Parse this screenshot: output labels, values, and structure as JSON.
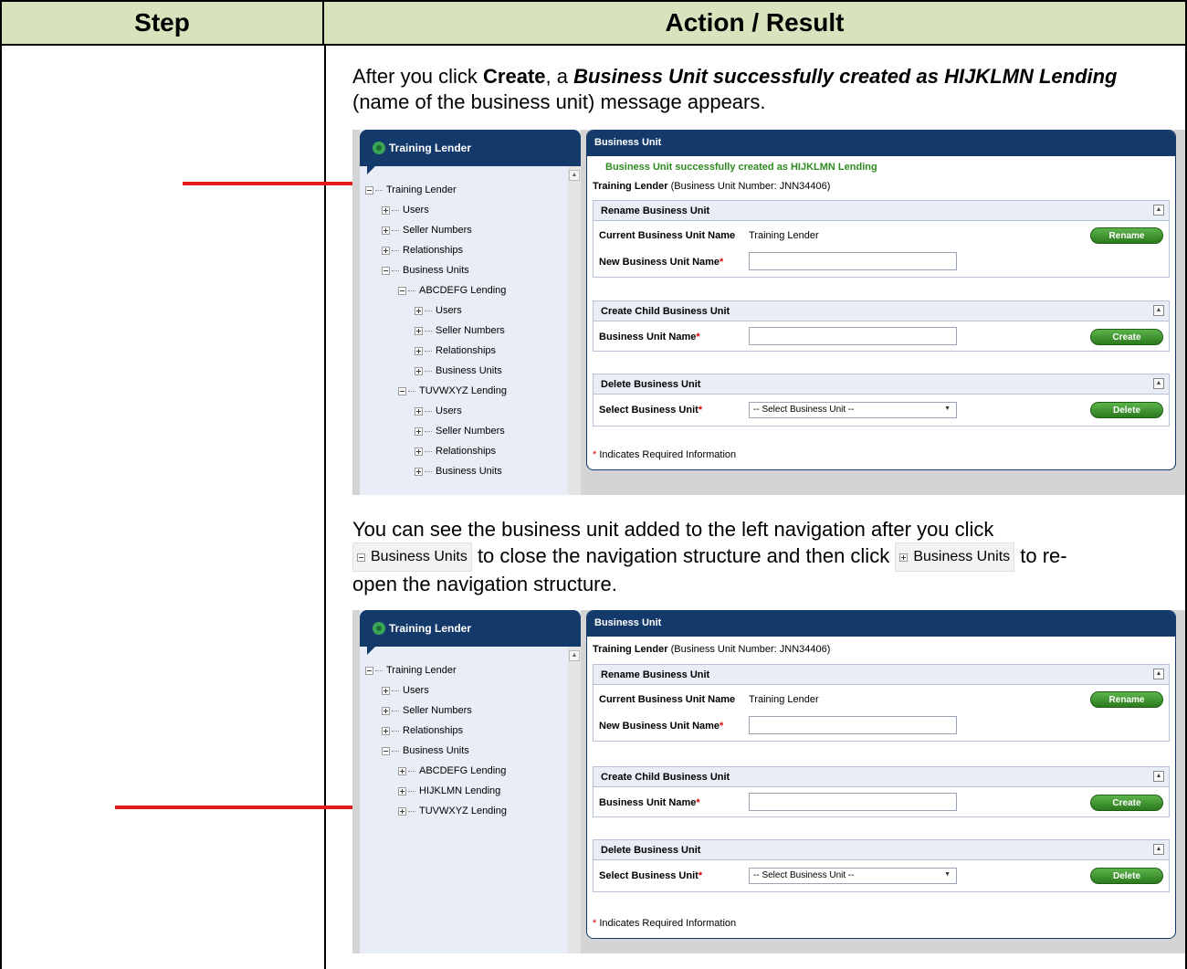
{
  "doc": {
    "header_step": "Step",
    "header_action": "Action / Result",
    "para1_pre": "After you click ",
    "para1_create": "Create",
    "para1_mid": ", a ",
    "para1_msg": "Business Unit successfully created as HIJKLMN Lending",
    "para1_post": " (name of the business unit) message appears.",
    "para2_a": "You can see the business unit added to the left navigation after you click",
    "para2_b": " to close the navigation structure and then click ",
    "para2_c": " to re-",
    "para2_d": "open the navigation structure.",
    "chip_label": "Business Units"
  },
  "shot1": {
    "nav_title": "Training Lender",
    "tree": [
      "Training Lender",
      "Users",
      "Seller Numbers",
      "Relationships",
      "Business Units",
      "ABCDEFG Lending",
      "Users",
      "Seller Numbers",
      "Relationships",
      "Business Units",
      "TUVWXYZ Lending",
      "Users",
      "Seller Numbers",
      "Relationships",
      "Business Units"
    ],
    "panel_title": "Business Unit",
    "success": "Business Unit successfully created as HIJKLMN Lending",
    "bu_name": "Training Lender",
    "bu_number": " (Business Unit Number: JNN34406)",
    "rename_title": "Rename Business Unit",
    "current_label": "Current Business Unit Name",
    "current_value": "Training Lender",
    "new_label": "New Business Unit Name",
    "rename_btn": "Rename",
    "child_title": "Create Child Business Unit",
    "child_label": "Business Unit Name",
    "create_btn": "Create",
    "delete_title": "Delete Business Unit",
    "select_label": "Select Business Unit",
    "select_value": "-- Select Business Unit --",
    "delete_btn": "Delete",
    "required_note": " Indicates Required Information",
    "asterisk": "*"
  },
  "shot2": {
    "nav_title": "Training Lender",
    "tree": [
      "Training Lender",
      "Users",
      "Seller Numbers",
      "Relationships",
      "Business Units",
      "ABCDEFG Lending",
      "HIJKLMN Lending",
      "TUVWXYZ Lending"
    ],
    "panel_title": "Business Unit",
    "bu_name": "Training Lender",
    "bu_number": " (Business Unit Number: JNN34406)",
    "rename_title": "Rename Business Unit",
    "current_label": "Current Business Unit Name",
    "current_value": "Training Lender",
    "new_label": "New Business Unit Name",
    "rename_btn": "Rename",
    "child_title": "Create Child Business Unit",
    "child_label": "Business Unit Name",
    "create_btn": "Create",
    "delete_title": "Delete Business Unit",
    "select_label": "Select Business Unit",
    "select_value": "-- Select Business Unit --",
    "delete_btn": "Delete",
    "required_note": " Indicates Required Information",
    "asterisk": "*"
  }
}
